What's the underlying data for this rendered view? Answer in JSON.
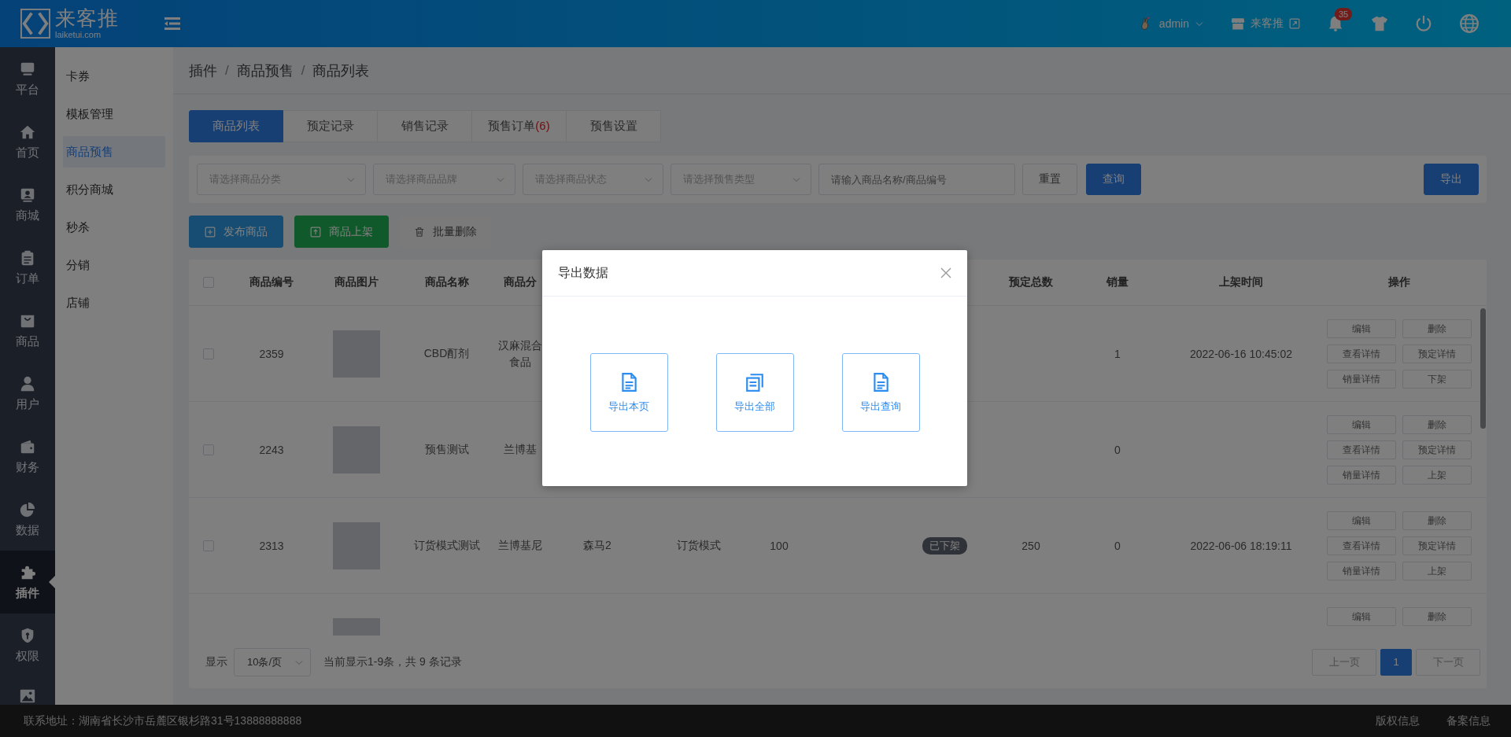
{
  "header": {
    "logo_text": "来客推",
    "logo_subtext": "laiketui.com",
    "user": "admin",
    "store": "来客推",
    "notifications": "35"
  },
  "nav_rail": [
    {
      "label": "平台",
      "selected": false
    },
    {
      "label": "首页",
      "selected": false
    },
    {
      "label": "商城",
      "selected": false
    },
    {
      "label": "订单",
      "selected": false
    },
    {
      "label": "商品",
      "selected": false
    },
    {
      "label": "用户",
      "selected": false
    },
    {
      "label": "财务",
      "selected": false
    },
    {
      "label": "数据",
      "selected": false
    },
    {
      "label": "插件",
      "selected": true
    },
    {
      "label": "权限",
      "selected": false
    }
  ],
  "submenu": [
    {
      "label": "卡券",
      "selected": false
    },
    {
      "label": "模板管理",
      "selected": false
    },
    {
      "label": "商品预售",
      "selected": true
    },
    {
      "label": "积分商城",
      "selected": false
    },
    {
      "label": "秒杀",
      "selected": false
    },
    {
      "label": "分销",
      "selected": false
    },
    {
      "label": "店铺",
      "selected": false
    }
  ],
  "breadcrumb": [
    {
      "kind": "link",
      "text": "插件"
    },
    {
      "kind": "separator",
      "text": "/"
    },
    {
      "kind": "link",
      "text": "商品预售"
    },
    {
      "kind": "separator",
      "text": "/"
    },
    {
      "kind": "current",
      "text": "商品列表"
    }
  ],
  "tabs": [
    {
      "label": "商品列表",
      "selected": true
    },
    {
      "label": "预定记录",
      "selected": false
    },
    {
      "label": "销售记录",
      "selected": false
    },
    {
      "label": "预售订单",
      "count": "(6)",
      "selected": false
    },
    {
      "label": "预售设置",
      "selected": false
    }
  ],
  "filters": {
    "selects": [
      {
        "placeholder": "请选择商品分类"
      },
      {
        "placeholder": "请选择商品品牌"
      },
      {
        "placeholder": "请选择商品状态"
      },
      {
        "placeholder": "请选择预售类型"
      }
    ],
    "search": {
      "placeholder": "请输入商品名称/商品编号"
    },
    "reset": "重置",
    "query": "查询",
    "export": "导出"
  },
  "actions": [
    {
      "kind": "primary",
      "label": "发布商品"
    },
    {
      "kind": "success",
      "label": "商品上架"
    },
    {
      "kind": "plain",
      "label": "批量删除"
    }
  ],
  "table": {
    "all_checked": false,
    "columns": [
      "商品编号",
      "商品图片",
      "商品名称",
      "商品分",
      "预定总数",
      "销量",
      "上架时间",
      "操作"
    ],
    "rows": [
      {
        "checked": false,
        "product_no": "2359",
        "name": "CBD酊剂",
        "category": [
          "汉麻混合",
          "食品"
        ],
        "sales": "1",
        "listed_time": "2022-06-16 10:45:02",
        "actions": [
          "编辑",
          "删除",
          "查看详情",
          "预定详情",
          "销量详情",
          "下架"
        ]
      },
      {
        "checked": false,
        "product_no": "2243",
        "name": "预售测试",
        "category": [
          "兰博基"
        ],
        "sales": "0",
        "actions": [
          "编辑",
          "删除",
          "查看详情",
          "预定详情",
          "销量详情",
          "上架"
        ]
      },
      {
        "checked": false,
        "product_no": "2313",
        "name": "订货模式测试",
        "category": [
          "兰博基尼"
        ],
        "column_5": "森马2",
        "column_6": "订货模式",
        "column_7": "100",
        "status": "已下架",
        "reserved_total": "250",
        "sales": "0",
        "listed_time": "2022-06-06 18:19:11",
        "actions": [
          "编辑",
          "删除",
          "查看详情",
          "预定详情",
          "销量详情",
          "上架"
        ]
      },
      {
        "actions": [
          "编辑",
          "删除"
        ]
      }
    ]
  },
  "pagination": {
    "show_label": "显示",
    "page_size": "10条/页",
    "summary": "当前显示1-9条，共 9 条记录",
    "prev": "上一页",
    "pages": [
      {
        "label": "1",
        "selected": true
      }
    ],
    "next": "下一页"
  },
  "footer": {
    "address": "联系地址：湖南省长沙市岳麓区银杉路31号13888888888",
    "links": [
      "版权信息",
      "备案信息"
    ]
  },
  "dialog": {
    "title": "导出数据",
    "options": [
      "导出本页",
      "导出全部",
      "导出查询"
    ]
  }
}
